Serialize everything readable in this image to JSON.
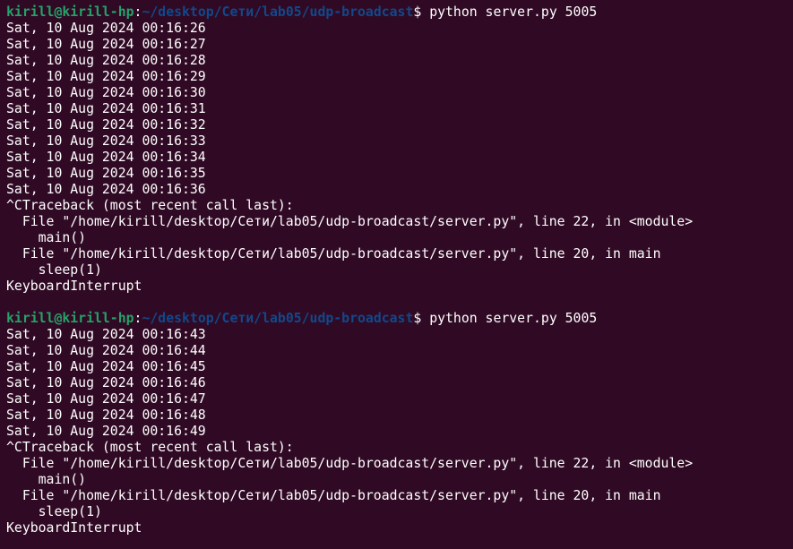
{
  "colors": {
    "background": "#300a24",
    "text": "#ffffff",
    "prompt_user": "#26a269",
    "prompt_path": "#12488b"
  },
  "sessions": [
    {
      "prompt": {
        "user_host": "kirill@kirill-hp",
        "separator": ":",
        "path": "~/desktop/Сети/lab05/udp-broadcast",
        "symbol": "$",
        "command": " python server.py 5005"
      },
      "output": [
        "Sat, 10 Aug 2024 00:16:26",
        "Sat, 10 Aug 2024 00:16:27",
        "Sat, 10 Aug 2024 00:16:28",
        "Sat, 10 Aug 2024 00:16:29",
        "Sat, 10 Aug 2024 00:16:30",
        "Sat, 10 Aug 2024 00:16:31",
        "Sat, 10 Aug 2024 00:16:32",
        "Sat, 10 Aug 2024 00:16:33",
        "Sat, 10 Aug 2024 00:16:34",
        "Sat, 10 Aug 2024 00:16:35",
        "Sat, 10 Aug 2024 00:16:36",
        "^CTraceback (most recent call last):",
        "  File \"/home/kirill/desktop/Сети/lab05/udp-broadcast/server.py\", line 22, in <module>",
        "    main()",
        "  File \"/home/kirill/desktop/Сети/lab05/udp-broadcast/server.py\", line 20, in main",
        "    sleep(1)",
        "KeyboardInterrupt",
        ""
      ]
    },
    {
      "prompt": {
        "user_host": "kirill@kirill-hp",
        "separator": ":",
        "path": "~/desktop/Сети/lab05/udp-broadcast",
        "symbol": "$",
        "command": " python server.py 5005"
      },
      "output": [
        "Sat, 10 Aug 2024 00:16:43",
        "Sat, 10 Aug 2024 00:16:44",
        "Sat, 10 Aug 2024 00:16:45",
        "Sat, 10 Aug 2024 00:16:46",
        "Sat, 10 Aug 2024 00:16:47",
        "Sat, 10 Aug 2024 00:16:48",
        "Sat, 10 Aug 2024 00:16:49",
        "^CTraceback (most recent call last):",
        "  File \"/home/kirill/desktop/Сети/lab05/udp-broadcast/server.py\", line 22, in <module>",
        "    main()",
        "  File \"/home/kirill/desktop/Сети/lab05/udp-broadcast/server.py\", line 20, in main",
        "    sleep(1)",
        "KeyboardInterrupt"
      ]
    }
  ]
}
